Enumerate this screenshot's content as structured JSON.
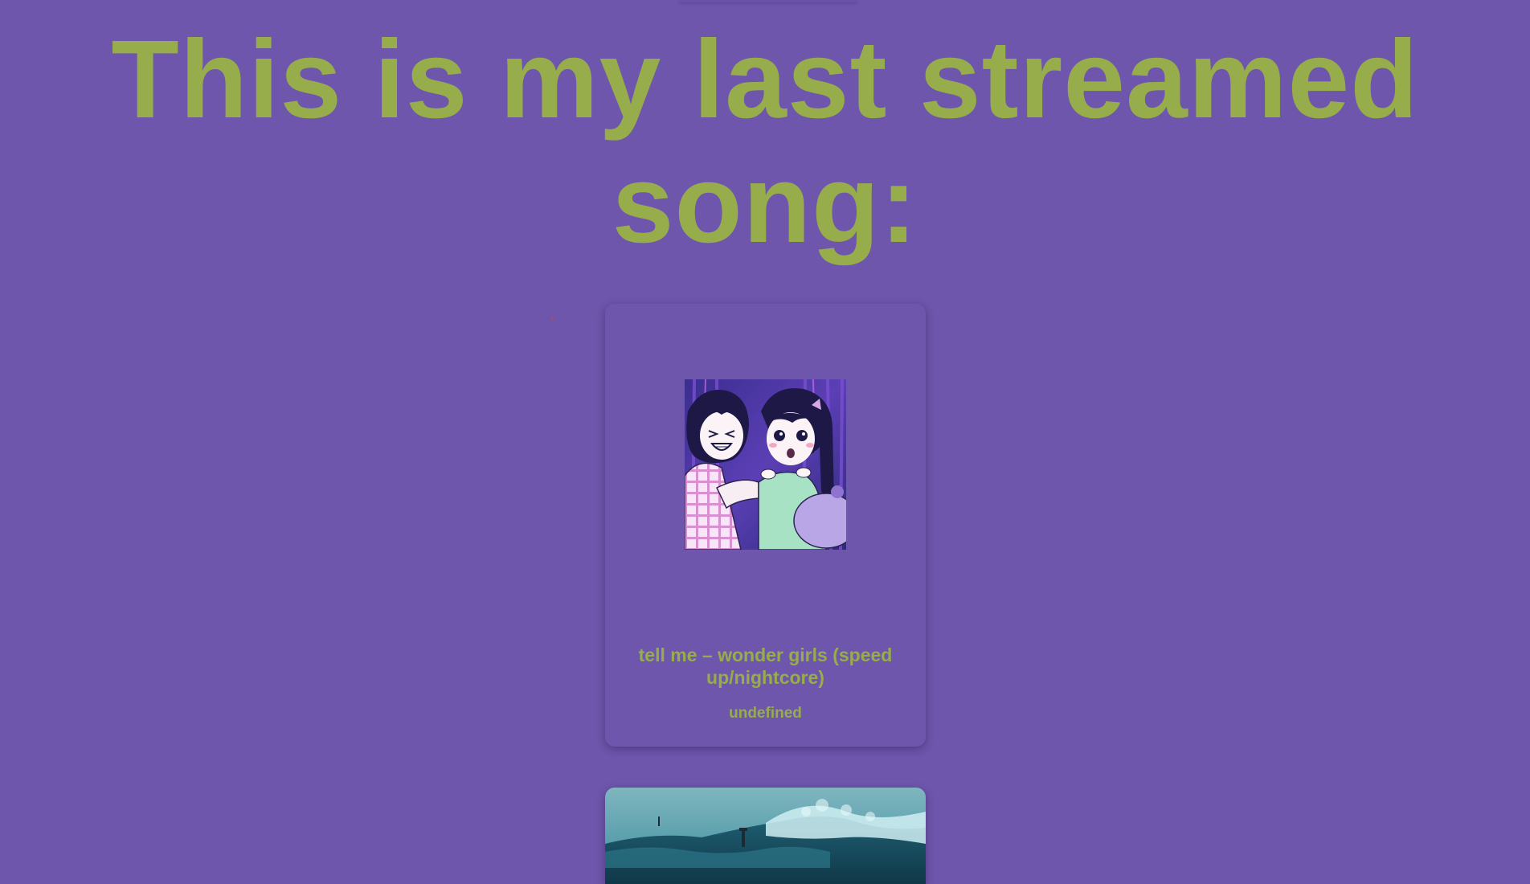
{
  "heading": {
    "text": "This is my last streamed song:"
  },
  "colors": {
    "background": "#6d56ab",
    "accent_text": "#97ad4b",
    "card_background": "#6d56ab"
  },
  "last_song": {
    "title": "tell me – wonder girls (speed up/nightcore)",
    "artist": "undefined",
    "cover_art": "anime-illustration-two-girls-cover"
  },
  "next_card": {
    "image": "stormy-sea-lighthouse-cover"
  }
}
